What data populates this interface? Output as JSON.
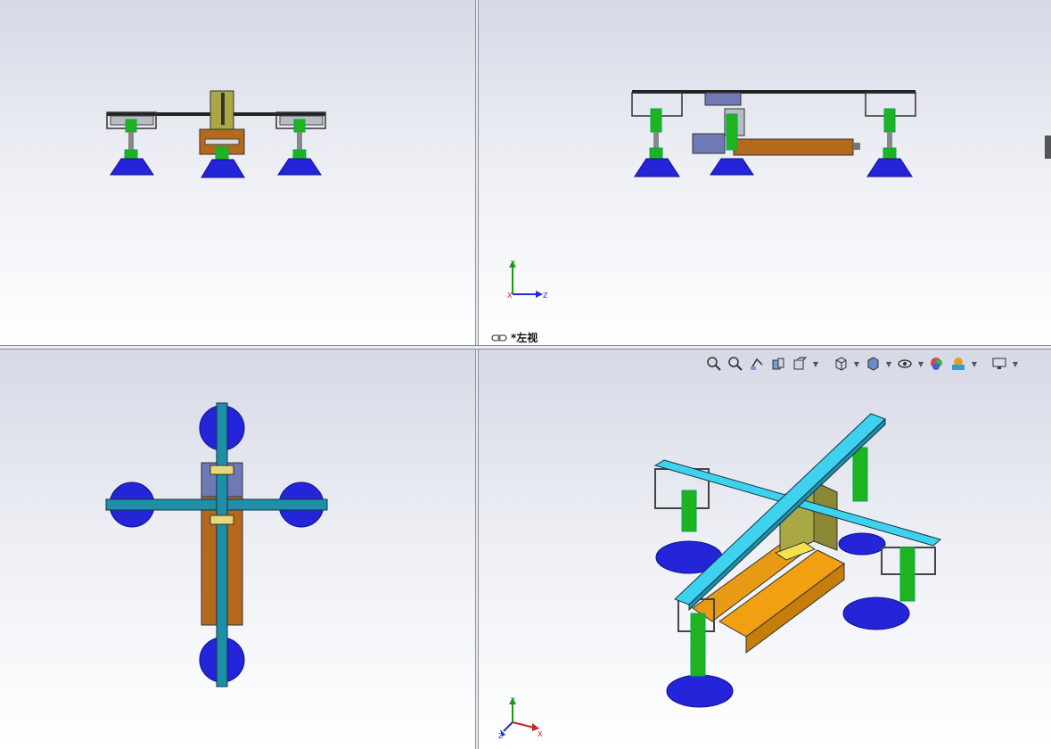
{
  "window": {
    "title": ""
  },
  "viewports": {
    "top_left": {
      "name": "front-view"
    },
    "top_right": {
      "name": "left-view",
      "label": "*左视",
      "triad": {
        "up": "Y",
        "right": "Z",
        "left": "X"
      }
    },
    "bottom_left": {
      "name": "top-view"
    },
    "bottom_right": {
      "name": "isometric-view",
      "triad": {
        "up": "Y",
        "right": "X",
        "left": "Z"
      }
    }
  },
  "toolbar": {
    "items": [
      {
        "icon": "zoom-to-fit-icon"
      },
      {
        "icon": "zoom-to-area-icon"
      },
      {
        "icon": "previous-view-icon"
      },
      {
        "icon": "section-view-icon"
      },
      {
        "icon": "dynamic-annotation-icon",
        "dropdown": true
      },
      {
        "icon": "view-orientation-icon",
        "dropdown": true
      },
      {
        "icon": "display-style-icon",
        "dropdown": true
      },
      {
        "icon": "hide-show-items-icon",
        "dropdown": true
      },
      {
        "icon": "edit-appearance-icon"
      },
      {
        "icon": "apply-scene-icon",
        "dropdown": true
      },
      {
        "icon": "view-settings-icon",
        "dropdown": true
      }
    ]
  },
  "colors": {
    "cup": "#2424d8",
    "cup_dark": "#10108a",
    "spring": "#1fb31f",
    "beam_cyan": "#3fd2ef",
    "beam_teal": "#1f8fa8",
    "cylinder_orange": "#f0a010",
    "cylinder_brown": "#b46a1a",
    "plate_olive": "#aaa844",
    "bracket_gray": "#b9bcc4",
    "block_slate": "#6f79b5"
  }
}
